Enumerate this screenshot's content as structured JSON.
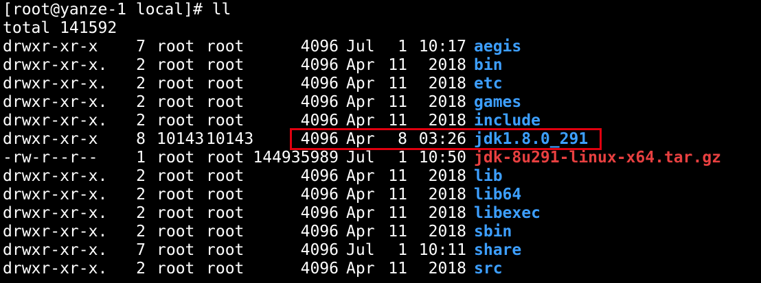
{
  "terminal": {
    "colors": {
      "background": "#000000",
      "text": "#ffffff",
      "directory": "#3d9fff",
      "archive": "#e84040",
      "highlight_box": "#e0000f"
    },
    "prompt_line": "[root@yanze-1 local]# ll",
    "total_line": "total 141592",
    "entries": [
      {
        "perm": "drwxr-xr-x",
        "links": "7",
        "owner": "root",
        "group": "root",
        "size": "4096",
        "month": "Jul",
        "day": "1",
        "time": "10:17",
        "name": "aegis",
        "kind": "dir"
      },
      {
        "perm": "drwxr-xr-x.",
        "links": "2",
        "owner": "root",
        "group": "root",
        "size": "4096",
        "month": "Apr",
        "day": "11",
        "time": "2018",
        "name": "bin",
        "kind": "dir"
      },
      {
        "perm": "drwxr-xr-x.",
        "links": "2",
        "owner": "root",
        "group": "root",
        "size": "4096",
        "month": "Apr",
        "day": "11",
        "time": "2018",
        "name": "etc",
        "kind": "dir"
      },
      {
        "perm": "drwxr-xr-x.",
        "links": "2",
        "owner": "root",
        "group": "root",
        "size": "4096",
        "month": "Apr",
        "day": "11",
        "time": "2018",
        "name": "games",
        "kind": "dir"
      },
      {
        "perm": "drwxr-xr-x.",
        "links": "2",
        "owner": "root",
        "group": "root",
        "size": "4096",
        "month": "Apr",
        "day": "11",
        "time": "2018",
        "name": "include",
        "kind": "dir"
      },
      {
        "perm": "drwxr-xr-x",
        "links": "8",
        "owner": "10143",
        "group": "10143",
        "size": "4096",
        "month": "Apr",
        "day": "8",
        "time": "03:26",
        "name": "jdk1.8.0_291",
        "kind": "dir",
        "highlighted": true
      },
      {
        "perm": "-rw-r--r--",
        "links": "1",
        "owner": "root",
        "group": "root",
        "size": "144935989",
        "month": "Jul",
        "day": "1",
        "time": "10:50",
        "name": "jdk-8u291-linux-x64.tar.gz",
        "kind": "archive"
      },
      {
        "perm": "drwxr-xr-x.",
        "links": "2",
        "owner": "root",
        "group": "root",
        "size": "4096",
        "month": "Apr",
        "day": "11",
        "time": "2018",
        "name": "lib",
        "kind": "dir"
      },
      {
        "perm": "drwxr-xr-x.",
        "links": "2",
        "owner": "root",
        "group": "root",
        "size": "4096",
        "month": "Apr",
        "day": "11",
        "time": "2018",
        "name": "lib64",
        "kind": "dir"
      },
      {
        "perm": "drwxr-xr-x.",
        "links": "2",
        "owner": "root",
        "group": "root",
        "size": "4096",
        "month": "Apr",
        "day": "11",
        "time": "2018",
        "name": "libexec",
        "kind": "dir"
      },
      {
        "perm": "drwxr-xr-x.",
        "links": "2",
        "owner": "root",
        "group": "root",
        "size": "4096",
        "month": "Apr",
        "day": "11",
        "time": "2018",
        "name": "sbin",
        "kind": "dir"
      },
      {
        "perm": "drwxr-xr-x.",
        "links": "7",
        "owner": "root",
        "group": "root",
        "size": "4096",
        "month": "Jul",
        "day": "1",
        "time": "10:11",
        "name": "share",
        "kind": "dir"
      },
      {
        "perm": "drwxr-xr-x.",
        "links": "2",
        "owner": "root",
        "group": "root",
        "size": "4096",
        "month": "Apr",
        "day": "11",
        "time": "2018",
        "name": "src",
        "kind": "dir"
      }
    ]
  }
}
